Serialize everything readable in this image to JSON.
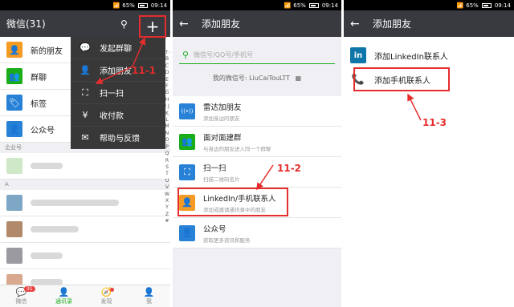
{
  "status": {
    "signal": "📶",
    "battery": "65%",
    "time": "09:14"
  },
  "p1": {
    "title": "微信(31)",
    "rows": [
      {
        "label": "新的朋友",
        "icon": "add-friend-icon",
        "color": "#f59b24",
        "glyph": "👤"
      },
      {
        "label": "群聊",
        "icon": "group-chat-icon",
        "color": "#1aad19",
        "glyph": "👥"
      },
      {
        "label": "标签",
        "icon": "tag-icon",
        "color": "#2782d7",
        "glyph": "🏷"
      },
      {
        "label": "公众号",
        "icon": "official-account-icon",
        "color": "#2782d7",
        "glyph": "👤"
      }
    ],
    "section_company": "企业号",
    "section_a": "A",
    "menu": [
      {
        "label": "发起群聊",
        "icon": "chat-bubble-icon",
        "glyph": "💬"
      },
      {
        "label": "添加朋友",
        "icon": "add-user-icon",
        "glyph": "👤"
      },
      {
        "label": "扫一扫",
        "icon": "scan-icon",
        "glyph": "⛶"
      },
      {
        "label": "收付款",
        "icon": "payment-icon",
        "glyph": "¥"
      },
      {
        "label": "帮助与反馈",
        "icon": "mail-icon",
        "glyph": "✉"
      }
    ],
    "annotation": "11-1",
    "alphabet": "↑☆A B C D E F G H I J K L M N O P Q R S T U V W X Y Z #",
    "tabs": [
      {
        "label": "微信",
        "glyph": "💬",
        "badge": "31"
      },
      {
        "label": "通讯录",
        "glyph": "👤"
      },
      {
        "label": "发现",
        "glyph": "🧭"
      },
      {
        "label": "我",
        "glyph": "👤"
      }
    ]
  },
  "p2": {
    "title": "添加朋友",
    "search_placeholder": "微信号/QQ号/手机号",
    "my_id": "我的微信号: LiuCaiTouLTT",
    "rows": [
      {
        "title": "雷达加朋友",
        "sub": "添加身边的朋友",
        "icon": "radar-icon",
        "color": "#2782d7",
        "glyph": "((•))"
      },
      {
        "title": "面对面建群",
        "sub": "与身边的朋友进入同一个群聊",
        "icon": "face-to-face-icon",
        "color": "#1aad19",
        "glyph": "👥"
      },
      {
        "title": "扫一扫",
        "sub": "扫描二维码名片",
        "icon": "scan-icon",
        "color": "#2782d7",
        "glyph": "⛶"
      },
      {
        "title": "LinkedIn/手机联系人",
        "sub": "添加或邀请通讯录中的朋友",
        "icon": "contacts-icon",
        "color": "#f59b24",
        "glyph": "👤"
      },
      {
        "title": "公众号",
        "sub": "获取更多资讯和服务",
        "icon": "official-account-icon",
        "color": "#2782d7",
        "glyph": "👤"
      }
    ],
    "annotation": "11-2"
  },
  "p3": {
    "title": "添加朋友",
    "rows": [
      {
        "label": "添加LinkedIn联系人",
        "icon": "linkedin-icon",
        "glyph": "in"
      },
      {
        "label": "添加手机联系人",
        "icon": "phone-icon",
        "glyph": "📞"
      }
    ],
    "annotation": "11-3"
  }
}
